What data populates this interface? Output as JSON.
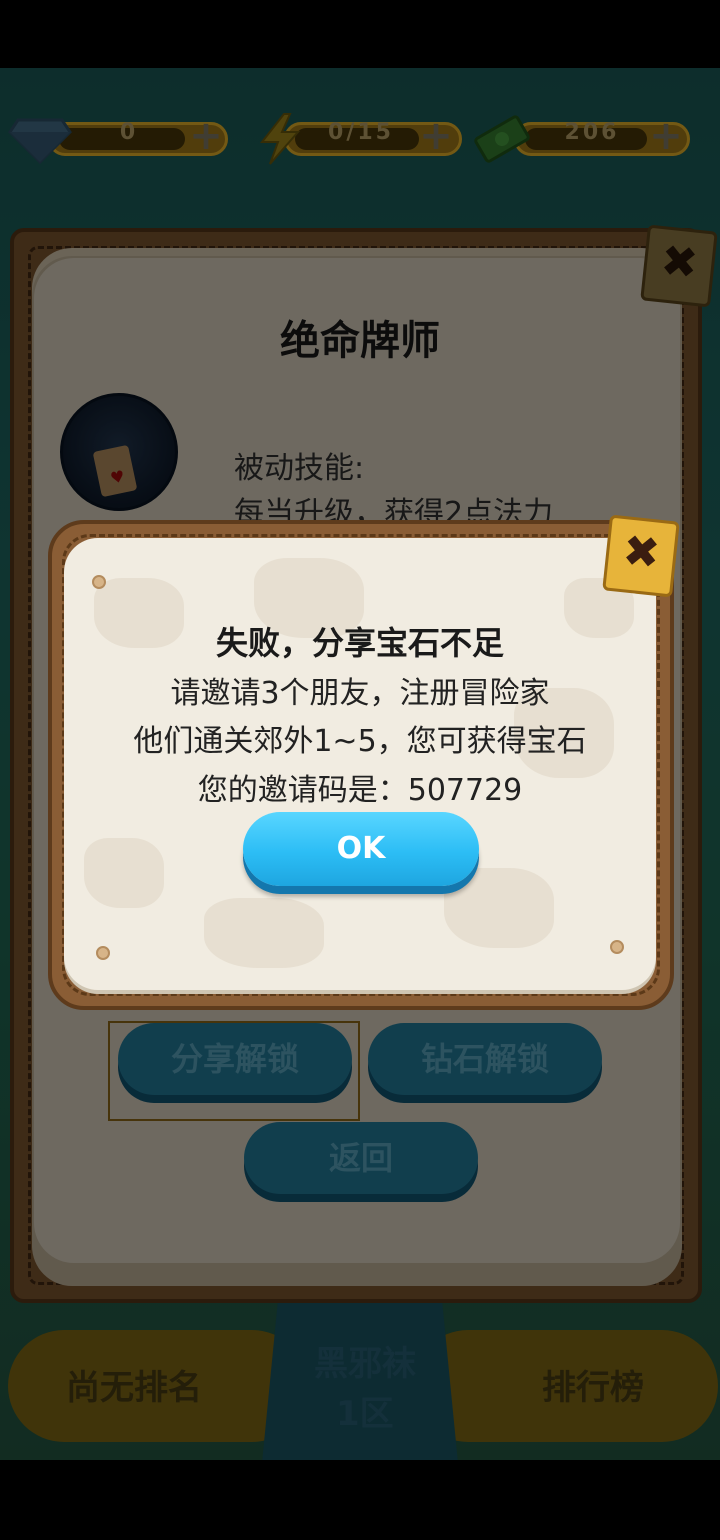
{
  "resources": {
    "gems": "0",
    "energy": "0/15",
    "cash": "206",
    "plus": "+"
  },
  "character": {
    "name": "绝命牌师",
    "skill_label": "被动技能:",
    "skill_desc": "每当升级，获得2点法力"
  },
  "panel_buttons": {
    "share_unlock": "分享解锁",
    "gem_unlock": "钻石解锁",
    "back": "返回"
  },
  "bottom_nav": {
    "rank_status": "尚无排名",
    "server_name": "黑邪袜",
    "server_zone": "1区",
    "leaderboard": "排行榜"
  },
  "dialog": {
    "title": "失败，分享宝石不足",
    "line1": "请邀请3个朋友，注册冒险家",
    "line2": "他们通关郊外1~5，您可获得宝石",
    "line3": "您的邀请码是：507729",
    "ok": "OK",
    "close": "✖"
  },
  "colors": {
    "ok_button": "#2cbdf5",
    "panel_brown": "#8a5d35",
    "paper": "#f1ece1",
    "close_tag": "#e7b43a"
  }
}
